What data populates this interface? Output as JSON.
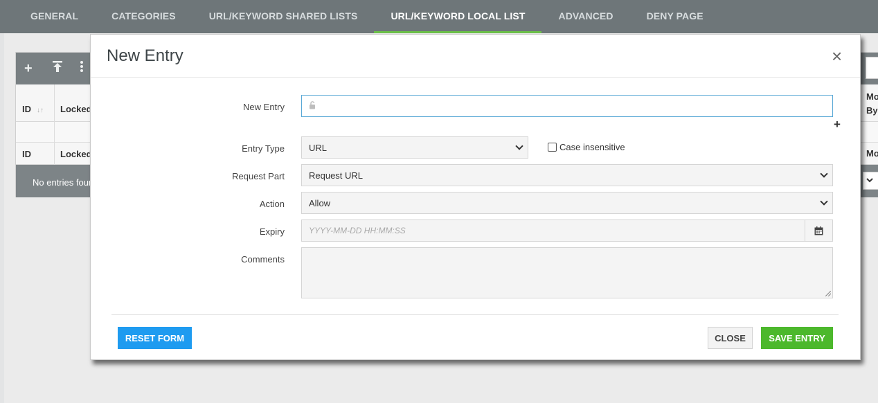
{
  "nav": {
    "tabs": [
      {
        "label": "GENERAL"
      },
      {
        "label": "CATEGORIES"
      },
      {
        "label": "URL/KEYWORD SHARED LISTS"
      },
      {
        "label": "URL/KEYWORD LOCAL LIST"
      },
      {
        "label": "ADVANCED"
      },
      {
        "label": "DENY PAGE"
      }
    ],
    "active_tab": "URL/KEYWORD LOCAL LIST"
  },
  "grid": {
    "toolbar_icons": [
      "plus-icon",
      "upload-icon",
      "more-vertical-icon"
    ],
    "columns": [
      "ID",
      "Locked"
    ],
    "filter_columns": [
      "ID",
      "Locked"
    ],
    "right_column_header": [
      "Mo",
      "By"
    ],
    "right_filter_text": "Mo",
    "empty_text": "No entries found"
  },
  "modal": {
    "title": "New Entry",
    "fields": {
      "new_entry": {
        "label": "New Entry",
        "value": ""
      },
      "entry_type": {
        "label": "Entry Type",
        "value": "URL"
      },
      "case_insensitive": {
        "label": "Case insensitive",
        "checked": false
      },
      "request_part": {
        "label": "Request Part",
        "value": "Request URL"
      },
      "action": {
        "label": "Action",
        "value": "Allow"
      },
      "expiry": {
        "label": "Expiry",
        "placeholder": "YYYY-MM-DD HH:MM:SS"
      },
      "comments": {
        "label": "Comments",
        "value": ""
      }
    },
    "buttons": {
      "reset": "RESET FORM",
      "close": "CLOSE",
      "save": "SAVE ENTRY"
    },
    "colors": {
      "reset": "#1e9bf0",
      "save": "#4cb82c",
      "active_tab_underline": "#6cc04a"
    }
  }
}
